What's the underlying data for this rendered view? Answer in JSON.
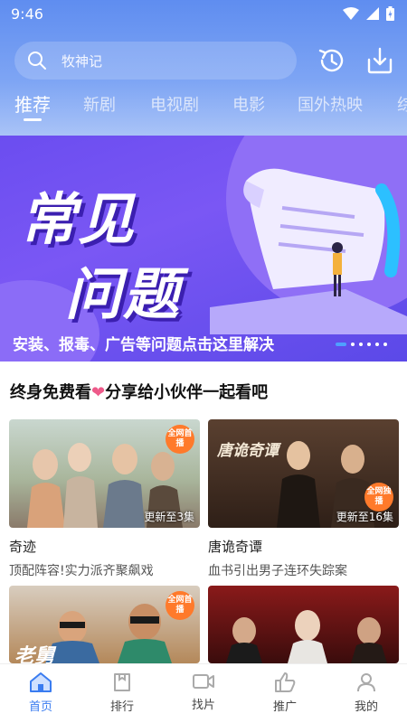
{
  "status_bar": {
    "time": "9:46"
  },
  "search": {
    "placeholder": "牧神记"
  },
  "tabs": [
    {
      "label": "推荐",
      "active": true
    },
    {
      "label": "新剧"
    },
    {
      "label": "电视剧"
    },
    {
      "label": "电影"
    },
    {
      "label": "国外热映"
    },
    {
      "label": "综"
    }
  ],
  "banner": {
    "title_line1": "常见",
    "title_line2": "问题",
    "caption": "安装、报毒、广告等问题点击这里解决"
  },
  "section": {
    "title_prefix": "终身免费看",
    "heart": "❤",
    "title_suffix": "分享给小伙伴一起看吧"
  },
  "cards": [
    {
      "name": "奇迹",
      "desc": "顶配阵容!实力派齐聚飙戏",
      "episode": "更新至3集",
      "badge": "全网首播"
    },
    {
      "name": "唐诡奇谭",
      "desc": "血书引出男子连环失踪案",
      "episode": "更新至16集",
      "badge": "全网独播",
      "poster_text": "唐诡奇谭"
    },
    {
      "name": "",
      "desc": "",
      "badge": "全网首播",
      "poster_text": "老舅"
    },
    {
      "name": "",
      "desc": ""
    }
  ],
  "bottom_nav": [
    {
      "label": "首页",
      "icon": "home-icon",
      "active": true
    },
    {
      "label": "排行",
      "icon": "rank-icon"
    },
    {
      "label": "找片",
      "icon": "video-icon"
    },
    {
      "label": "推广",
      "icon": "thumbs-up-icon"
    },
    {
      "label": "我的",
      "icon": "user-icon"
    }
  ],
  "colors": {
    "header": "#6a95f2",
    "active_nav": "#3a7cf0",
    "banner": "#6b4df0",
    "badge": "#ff7a2b"
  }
}
